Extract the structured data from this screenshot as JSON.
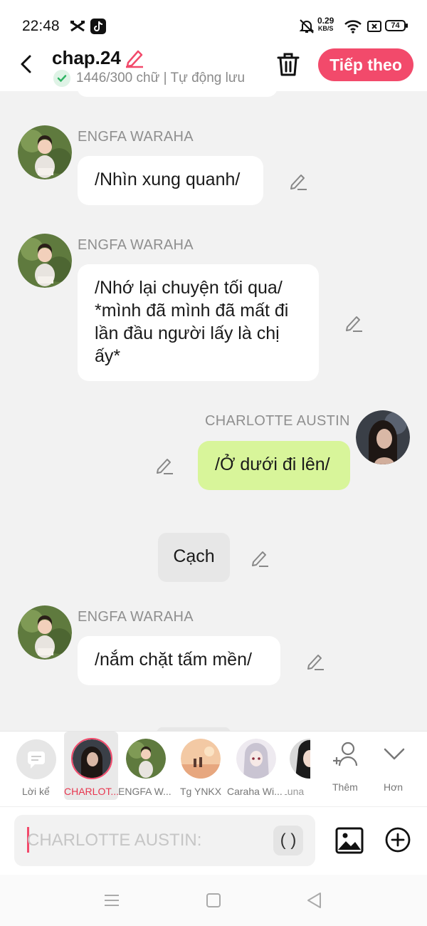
{
  "status_bar": {
    "time": "22:48",
    "net_speed": "0.29",
    "net_unit": "KB/S",
    "battery": "74",
    "icons": [
      "capcut-icon",
      "tiktok-icon",
      "bell-off-icon",
      "wifi-icon",
      "sim-icon",
      "battery-icon"
    ]
  },
  "header": {
    "title": "chap.24",
    "word_count": "1446/300 chữ | Tự động lưu",
    "next_label": "Tiếp theo"
  },
  "messages": [
    {
      "sender": "ENGFA WARAHA",
      "text": "/Nhìn xung quanh/",
      "side": "left"
    },
    {
      "sender": "ENGFA WARAHA",
      "text_lines": [
        "/Nhớ lại chuyện tối qua/",
        "*mình đã mình đã mất đi",
        "lần đầu người lấy là chị",
        "ấy*"
      ],
      "side": "left"
    },
    {
      "sender": "CHARLOTTE AUSTIN",
      "text": "/Ở dưới đi lên/",
      "side": "right"
    },
    {
      "narration": "Cạch"
    },
    {
      "sender": "ENGFA WARAHA",
      "text": "/nắm chặt tấm mền/",
      "side": "left"
    }
  ],
  "characters": [
    {
      "label": "Lời kể"
    },
    {
      "label": "CHARLOT..."
    },
    {
      "label": "ENGFA W..."
    },
    {
      "label": "Tg YNKX"
    },
    {
      "label": "Caraha Wi..."
    },
    {
      "label": "Luna"
    }
  ],
  "char_tools": {
    "add_label": "Thêm",
    "more_label": "Hơn"
  },
  "input": {
    "placeholder": "CHARLOTTE AUSTIN:",
    "paren_label": "( )"
  },
  "colors": {
    "accent": "#f24a6b",
    "green_bubble": "#d8f59a",
    "background": "#f2f2f2"
  }
}
